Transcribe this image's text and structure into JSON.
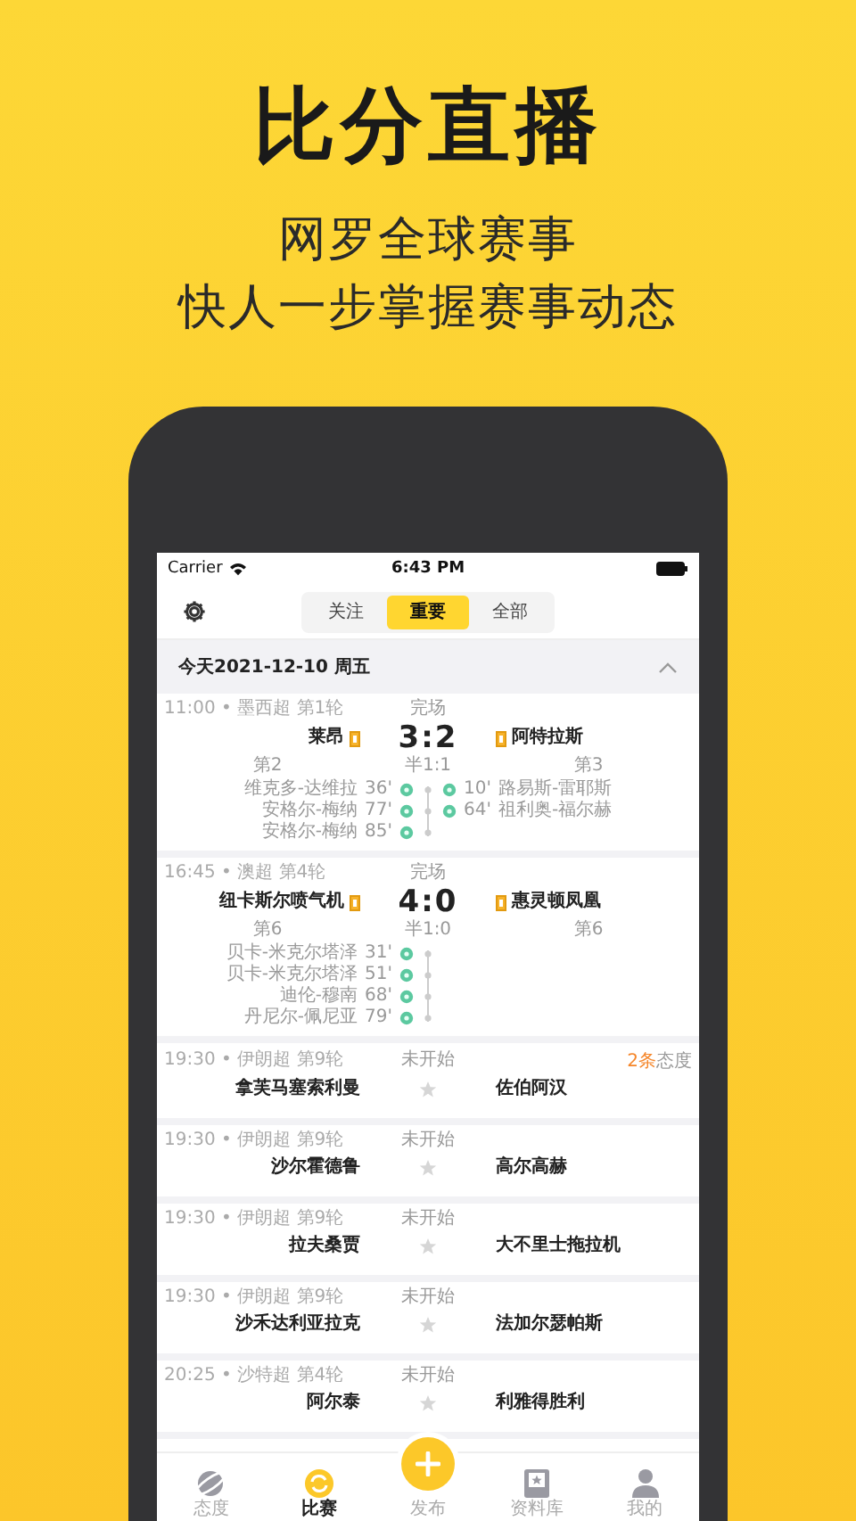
{
  "headline": "比分直播",
  "subtitle_lines": [
    "网罗全球赛事",
    "快人一步掌握赛事动态"
  ],
  "status_bar": {
    "carrier": "Carrier",
    "time": "6:43 PM"
  },
  "segments": [
    {
      "label": "关注",
      "selected": false
    },
    {
      "label": "重要",
      "selected": true
    },
    {
      "label": "全部",
      "selected": false
    }
  ],
  "date_header": {
    "label": "今天2021-12-10 周五",
    "expanded": true
  },
  "matches": [
    {
      "kind": "finished",
      "meta": "11:00 • 墨西超 第1轮",
      "status": "完场",
      "home": "莱昂",
      "away": "阿特拉斯",
      "score": "3:2",
      "home_card": true,
      "away_card": true,
      "home_rank": "第2",
      "away_rank": "第3",
      "halftime": "半1:1",
      "home_goals": [
        {
          "player": "维克多-达维拉",
          "minute": "36'"
        },
        {
          "player": "安格尔-梅纳",
          "minute": "77'"
        },
        {
          "player": "安格尔-梅纳",
          "minute": "85'"
        }
      ],
      "away_goals": [
        {
          "player": "路易斯-雷耶斯",
          "minute": "10'"
        },
        {
          "player": "祖利奥-福尔赫",
          "minute": "64'"
        }
      ]
    },
    {
      "kind": "finished",
      "meta": "16:45 • 澳超 第4轮",
      "status": "完场",
      "home": "纽卡斯尔喷气机",
      "away": "惠灵顿凤凰",
      "score": "4:0",
      "home_card": true,
      "away_card": true,
      "home_rank": "第6",
      "away_rank": "第6",
      "halftime": "半1:0",
      "home_goals": [
        {
          "player": "贝卡-米克尔塔泽",
          "minute": "31'"
        },
        {
          "player": "贝卡-米克尔塔泽",
          "minute": "51'"
        },
        {
          "player": "迪伦-穆南",
          "minute": "68'"
        },
        {
          "player": "丹尼尔-佩尼亚",
          "minute": "79'"
        }
      ]
    },
    {
      "kind": "upcoming",
      "meta": "19:30 • 伊朗超 第9轮",
      "status": "未开始",
      "home": "拿芙马塞索利曼",
      "away": "佐伯阿汉",
      "opinion": {
        "count": "2条",
        "label": "态度"
      }
    },
    {
      "kind": "upcoming",
      "meta": "19:30 • 伊朗超 第9轮",
      "status": "未开始",
      "home": "沙尔霍德鲁",
      "away": "高尔高赫"
    },
    {
      "kind": "upcoming",
      "meta": "19:30 • 伊朗超 第9轮",
      "status": "未开始",
      "home": "拉夫桑贾",
      "away": "大不里士拖拉机"
    },
    {
      "kind": "upcoming",
      "meta": "19:30 • 伊朗超 第9轮",
      "status": "未开始",
      "home": "沙禾达利亚拉克",
      "away": "法加尔瑟帕斯"
    },
    {
      "kind": "upcoming",
      "meta": "20:25 • 沙特超 第4轮",
      "status": "未开始",
      "home": "阿尔泰",
      "away": "利雅得胜利"
    }
  ],
  "tab_bar": [
    {
      "kind": "tab",
      "label": "态度",
      "selected": false
    },
    {
      "kind": "tab",
      "label": "比赛",
      "selected": true
    },
    {
      "kind": "publish",
      "label": "发布",
      "selected": false
    },
    {
      "kind": "tab",
      "label": "资料库",
      "selected": false
    },
    {
      "kind": "tab",
      "label": "我的",
      "selected": false
    }
  ]
}
